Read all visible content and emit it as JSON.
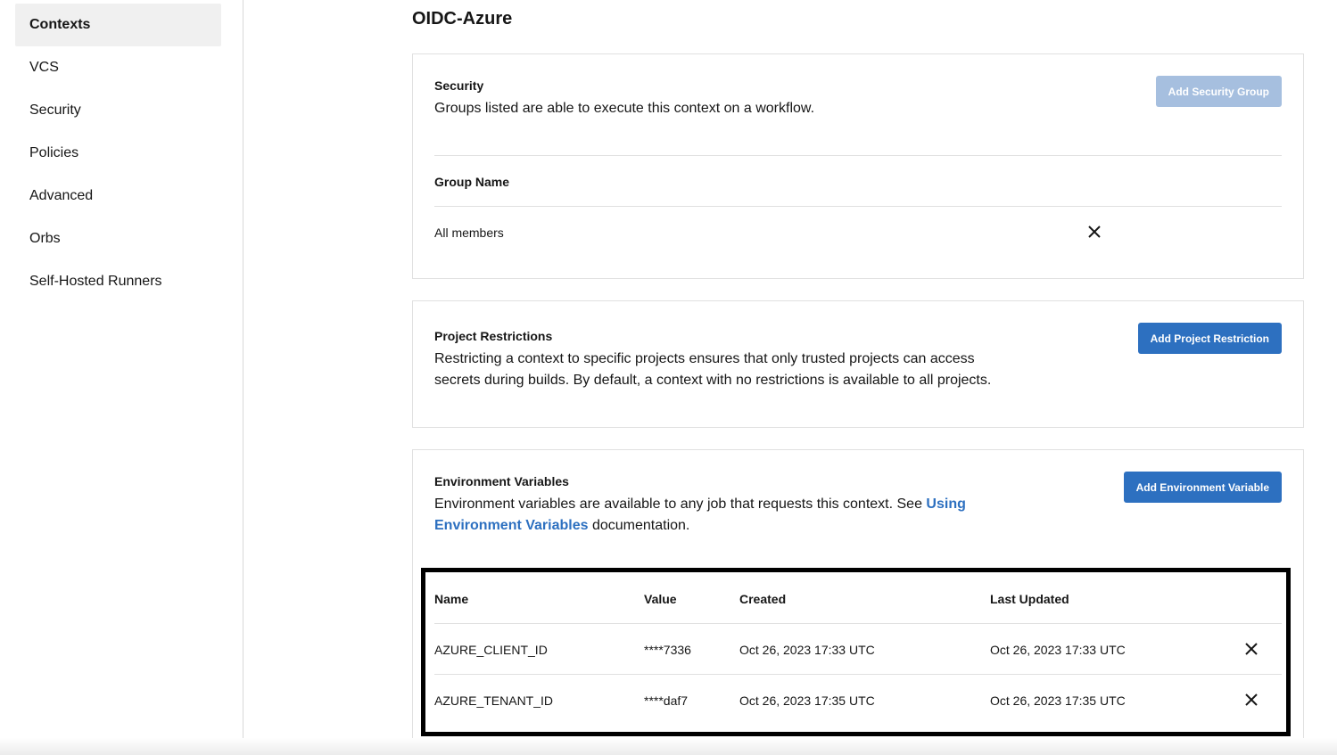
{
  "sidebar": {
    "items": [
      {
        "label": "Contexts",
        "active": true
      },
      {
        "label": "VCS"
      },
      {
        "label": "Security"
      },
      {
        "label": "Policies"
      },
      {
        "label": "Advanced"
      },
      {
        "label": "Orbs"
      },
      {
        "label": "Self-Hosted Runners"
      }
    ]
  },
  "page": {
    "title": "OIDC-Azure"
  },
  "security": {
    "title": "Security",
    "description": "Groups listed are able to execute this context on a workflow.",
    "add_button": "Add Security Group",
    "column_header": "Group Name",
    "rows": [
      {
        "group": "All members"
      }
    ]
  },
  "project_restrictions": {
    "title": "Project Restrictions",
    "description": "Restricting a context to specific projects ensures that only trusted projects can access secrets during builds. By default, a context with no restrictions is available to all projects.",
    "add_button": "Add Project Restriction"
  },
  "env_vars": {
    "title": "Environment Variables",
    "description_before": "Environment variables are available to any job that requests this context. See ",
    "link_text": "Using Environment Variables",
    "description_after": " documentation.",
    "add_button": "Add Environment Variable",
    "columns": {
      "name": "Name",
      "value": "Value",
      "created": "Created",
      "updated": "Last Updated"
    },
    "rows": [
      {
        "name": "AZURE_CLIENT_ID",
        "value": "****7336",
        "created": "Oct 26, 2023 17:33 UTC",
        "updated": "Oct 26, 2023 17:33 UTC"
      },
      {
        "name": "AZURE_TENANT_ID",
        "value": "****daf7",
        "created": "Oct 26, 2023 17:35 UTC",
        "updated": "Oct 26, 2023 17:35 UTC"
      }
    ]
  },
  "colors": {
    "accent": "#2d70c0",
    "accent_disabled": "#a6bfdf",
    "active_bg": "#f0f0f0"
  }
}
